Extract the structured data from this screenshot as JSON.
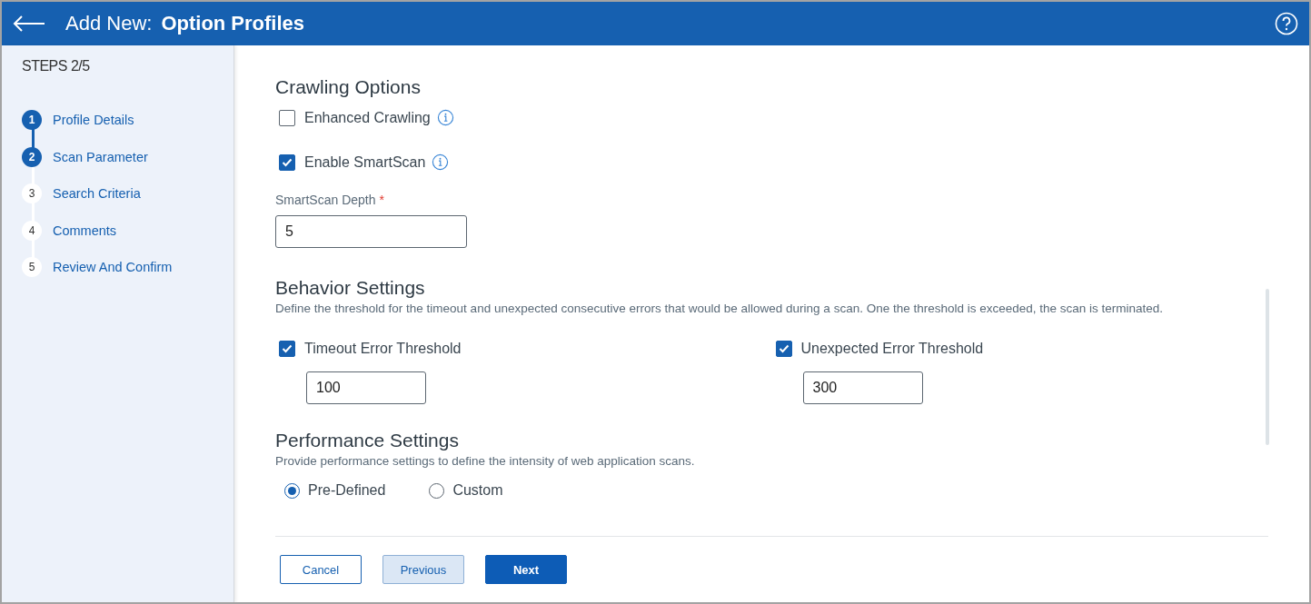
{
  "header": {
    "title_prefix": "Add New:",
    "title": "Option Profiles"
  },
  "sidebar": {
    "steps_label": "STEPS 2/5",
    "steps": [
      {
        "number": "1",
        "label": "Profile Details",
        "reached": true,
        "completed": true
      },
      {
        "number": "2",
        "label": "Scan Parameter",
        "reached": true,
        "completed": false
      },
      {
        "number": "3",
        "label": "Search Criteria",
        "reached": false,
        "completed": false
      },
      {
        "number": "4",
        "label": "Comments",
        "reached": false,
        "completed": false
      },
      {
        "number": "5",
        "label": "Review And Confirm",
        "reached": false
      }
    ]
  },
  "crawling_options": {
    "title": "Crawling Options",
    "options": [
      {
        "label": "Enhanced Crawling",
        "checked": false
      },
      {
        "label": "Enable SmartScan",
        "checked": true
      }
    ],
    "depth_field": {
      "label": "SmartScan Depth",
      "required_mark": "*",
      "value": "5"
    }
  },
  "behavior_settings": {
    "title": "Behavior Settings",
    "description": "Define the threshold for the timeout and unexpected consecutive errors that would be allowed during a scan. One the threshold is exceeded, the scan is terminated.",
    "thresholds": [
      {
        "label": "Timeout Error Threshold",
        "checked": true,
        "value": "100"
      },
      {
        "label": "Unexpected Error Threshold",
        "checked": true,
        "value": "300"
      }
    ]
  },
  "performance_settings": {
    "title": "Performance Settings",
    "description": "Provide performance settings to define the intensity of web application scans.",
    "modes": [
      {
        "label": "Pre-Defined",
        "selected": true
      },
      {
        "label": "Custom",
        "selected": false
      }
    ]
  },
  "buttons": [
    {
      "label": "Cancel",
      "kind": "outline"
    },
    {
      "label": "Previous",
      "kind": "secondary"
    },
    {
      "label": "Next",
      "kind": "primary"
    }
  ]
}
